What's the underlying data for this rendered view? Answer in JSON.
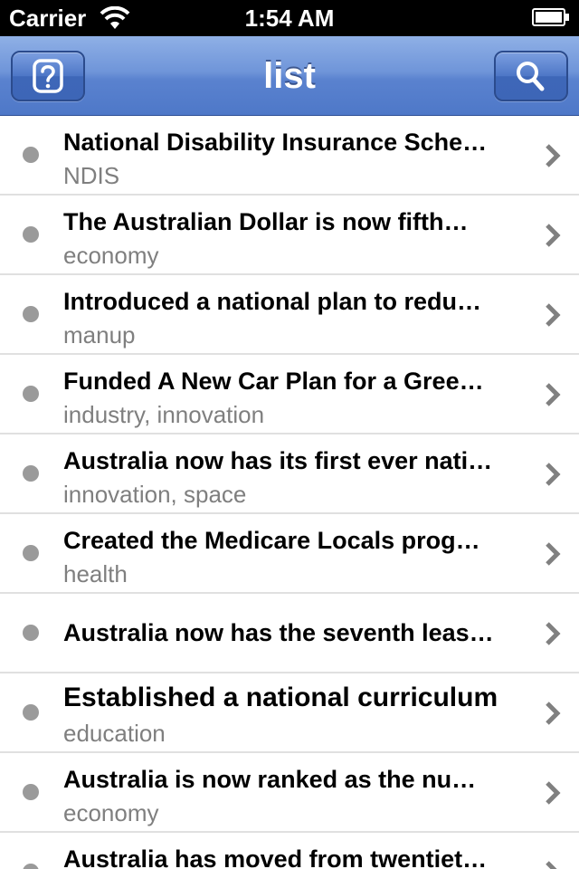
{
  "status_bar": {
    "carrier": "Carrier",
    "time": "1:54 AM"
  },
  "nav_bar": {
    "title": "list",
    "left_button_icon": "help-icon",
    "right_button_icon": "search-icon"
  },
  "colors": {
    "nav_bar": "#5a82cf",
    "bullet": "#9a9a9a",
    "subtitle": "#7f7f7f",
    "separator": "#e0e0e0",
    "chevron": "#808080"
  },
  "list": {
    "items": [
      {
        "title": "National Disability Insurance Sche…",
        "subtitle": "NDIS"
      },
      {
        "title": "The Australian Dollar is now fifth…",
        "subtitle": "economy"
      },
      {
        "title": "Introduced a national plan to redu…",
        "subtitle": "manup"
      },
      {
        "title": "Funded A New Car Plan for a Gree…",
        "subtitle": "industry, innovation"
      },
      {
        "title": "Australia now has its first ever nati…",
        "subtitle": "innovation, space"
      },
      {
        "title": "Created the Medicare Locals prog…",
        "subtitle": "health"
      },
      {
        "title": "Australia now has the seventh leas…",
        "subtitle": ""
      },
      {
        "title": "Established a national curriculum",
        "subtitle": "education"
      },
      {
        "title": "Australia is now ranked as the nu…",
        "subtitle": "economy"
      },
      {
        "title": "Australia has moved from twentiet…",
        "subtitle": ""
      }
    ]
  }
}
